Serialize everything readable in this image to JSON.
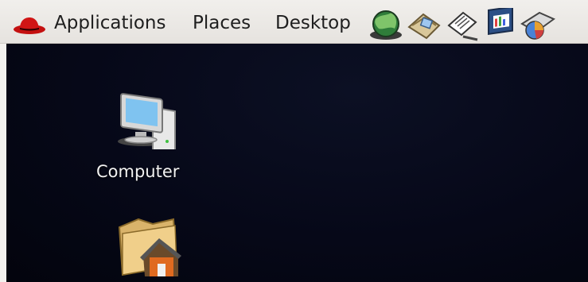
{
  "panel": {
    "menus": [
      {
        "label": "Applications"
      },
      {
        "label": "Places"
      },
      {
        "label": "Desktop"
      }
    ],
    "logo_icon": "redhat-logo-icon",
    "launchers": [
      {
        "icon": "web-browser-icon"
      },
      {
        "icon": "email-client-icon"
      },
      {
        "icon": "text-editor-icon"
      },
      {
        "icon": "presentation-icon"
      },
      {
        "icon": "chart-app-icon"
      }
    ]
  },
  "desktop": {
    "icons": [
      {
        "label": "Computer",
        "icon": "computer-icon"
      },
      {
        "label": "",
        "icon": "home-folder-icon"
      }
    ]
  },
  "colors": {
    "panel_bg": "#e6e3df",
    "desktop_bg": "#060818",
    "label_text": "#f2f2f2"
  }
}
